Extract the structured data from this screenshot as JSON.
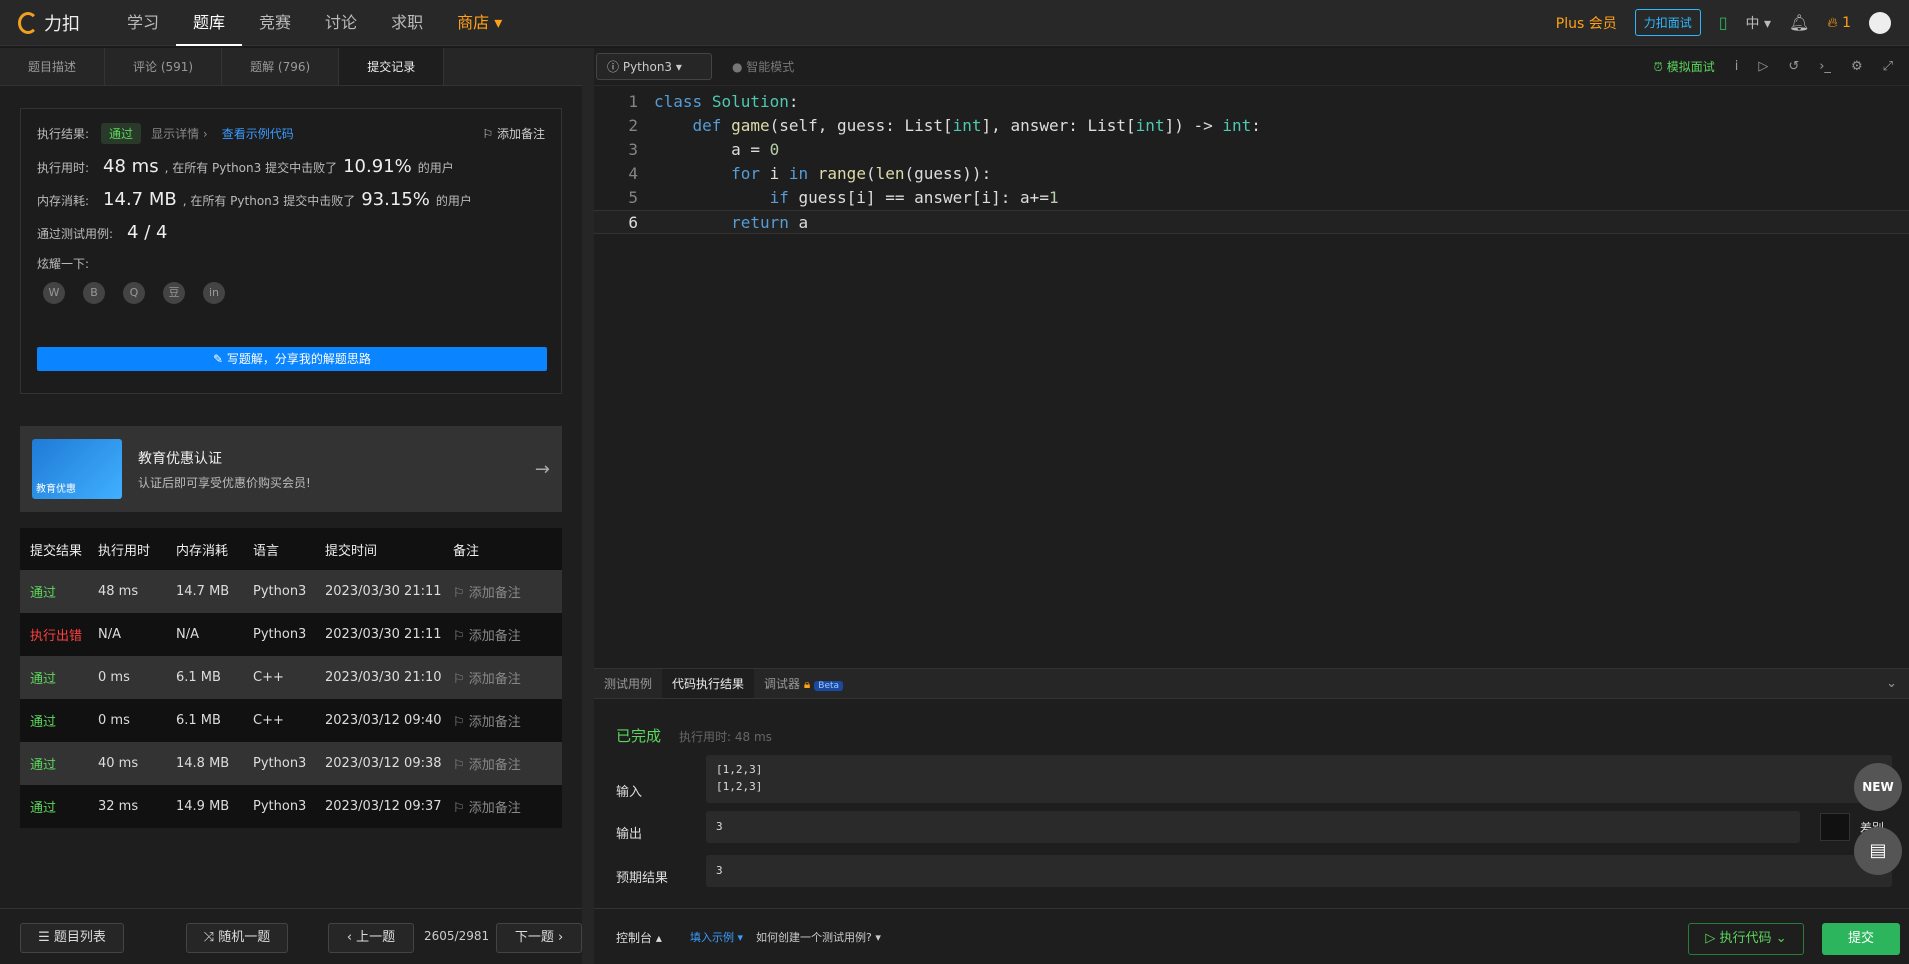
{
  "logo": "力扣",
  "nav": [
    "学习",
    "题库",
    "竞赛",
    "讨论",
    "求职",
    "商店"
  ],
  "topright": {
    "plus": "Plus 会员",
    "interview": "力扣面试",
    "lang": "中",
    "fire": "1"
  },
  "tabs": [
    "题目描述",
    "评论 (591)",
    "题解 (796)",
    "提交记录"
  ],
  "result": {
    "label_result": "执行结果:",
    "status": "通过",
    "detail": "显示详情 ›",
    "example_link": "查看示例代码",
    "add_note": "添加备注",
    "time_label": "执行用时:",
    "time_value": "48 ms",
    "time_text1": ", 在所有 Python3 提交中击败了",
    "time_pct": "10.91%",
    "time_text2": "的用户",
    "mem_label": "内存消耗:",
    "mem_value": "14.7 MB",
    "mem_text1": ", 在所有 Python3 提交中击败了",
    "mem_pct": "93.15%",
    "mem_text2": "的用户",
    "tests_label": "通过测试用例:",
    "tests_value": "4 / 4",
    "share_label": "炫耀一下:",
    "share_icons": [
      "wechat-icon",
      "weibo-icon",
      "qq-icon",
      "douban-icon",
      "linkedin-icon"
    ],
    "write_btn": "写题解，分享我的解题思路"
  },
  "edu": {
    "badge": "教育优惠",
    "title": "教育优惠认证",
    "subtitle": "认证后即可享受优惠价购买会员!"
  },
  "table": {
    "headers": [
      "提交结果",
      "执行用时",
      "内存消耗",
      "语言",
      "提交时间",
      "备注"
    ],
    "rows": [
      {
        "status": "通过",
        "time": "48 ms",
        "mem": "14.7 MB",
        "lang": "Python3",
        "date": "2023/03/30 21:11",
        "note": "添加备注",
        "err": false
      },
      {
        "status": "执行出错",
        "time": "N/A",
        "mem": "N/A",
        "lang": "Python3",
        "date": "2023/03/30 21:11",
        "note": "添加备注",
        "err": true
      },
      {
        "status": "通过",
        "time": "0 ms",
        "mem": "6.1 MB",
        "lang": "C++",
        "date": "2023/03/30 21:10",
        "note": "添加备注",
        "err": false
      },
      {
        "status": "通过",
        "time": "0 ms",
        "mem": "6.1 MB",
        "lang": "C++",
        "date": "2023/03/12 09:40",
        "note": "添加备注",
        "err": false
      },
      {
        "status": "通过",
        "time": "40 ms",
        "mem": "14.8 MB",
        "lang": "Python3",
        "date": "2023/03/12 09:38",
        "note": "添加备注",
        "err": false
      },
      {
        "status": "通过",
        "time": "32 ms",
        "mem": "14.9 MB",
        "lang": "Python3",
        "date": "2023/03/12 09:37",
        "note": "添加备注",
        "err": false
      }
    ]
  },
  "bottom": {
    "list": "题目列表",
    "random": "随机一题",
    "prev": "上一题",
    "page": "2605/2981",
    "next": "下一题"
  },
  "editor": {
    "language": "Python3",
    "smart_mode": "智能模式",
    "mock": "模拟面试",
    "lines": [
      "class Solution:",
      "    def game(self, guess: List[int], answer: List[int]) -> int:",
      "        a = 0",
      "        for i in range(len(guess)):",
      "            if guess[i] == answer[i]: a+=1",
      "        return a"
    ]
  },
  "console": {
    "tabs": [
      "测试用例",
      "代码执行结果",
      "调试器"
    ],
    "beta": "Beta",
    "done": "已完成",
    "runtime": "执行用时: 48 ms",
    "input_label": "输入",
    "input_lines": [
      "[1,2,3]",
      "[1,2,3]"
    ],
    "output_label": "输出",
    "output": "3",
    "expected_label": "预期结果",
    "expected": "3",
    "diff": "差别",
    "new_badge": "NEW",
    "footer_console": "控制台",
    "footer_fill": "填入示例",
    "footer_howto": "如何创建一个测试用例?",
    "run": "执行代码",
    "submit": "提交"
  }
}
